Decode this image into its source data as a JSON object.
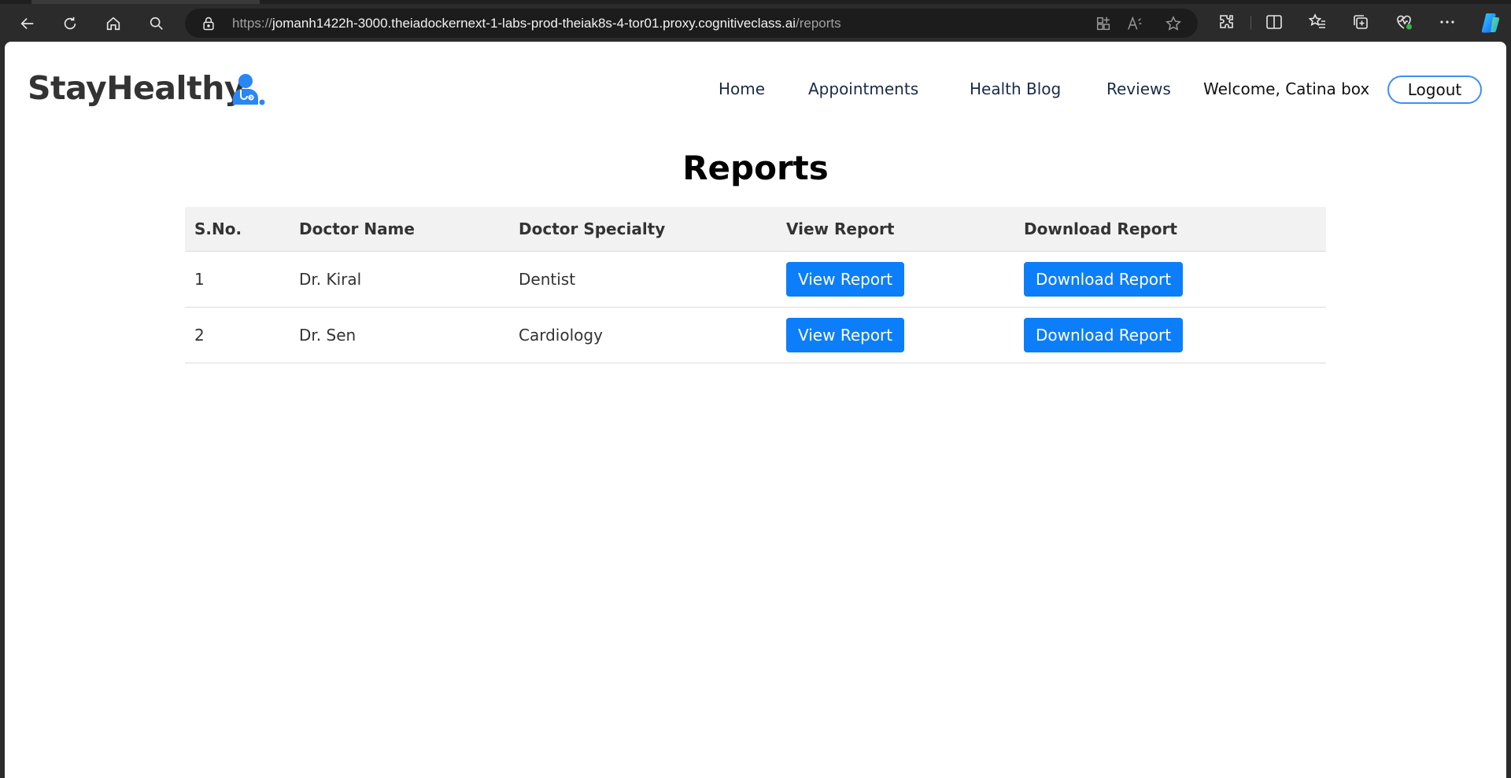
{
  "browser": {
    "url_scheme": "https://",
    "url_host": "jomanh1422h-3000.theiadockernext-1-labs-prod-theiak8s-4-tor01.proxy.cognitiveclass.ai",
    "url_path": "/reports",
    "icons": [
      "back-icon",
      "refresh-icon",
      "home-icon",
      "search-icon",
      "lock-icon",
      "apps-icon",
      "read-aloud-icon",
      "favorite-star-icon",
      "extensions-icon",
      "split-screen-icon",
      "favorites-icon",
      "collections-icon",
      "browser-health-icon",
      "more-icon",
      "copilot-icon"
    ]
  },
  "navbar": {
    "brand": "StayHealthy",
    "links": [
      "Home",
      "Appointments",
      "Health Blog",
      "Reviews"
    ],
    "welcome": "Welcome, Catina box",
    "logout": "Logout",
    "accent": "#3f8ef5"
  },
  "main": {
    "title": "Reports",
    "table": {
      "headers": [
        "S.No.",
        "Doctor Name",
        "Doctor Specialty",
        "View Report",
        "Download Report"
      ],
      "rows": [
        {
          "sno": "1",
          "name": "Dr. Kiral",
          "specialty": "Dentist",
          "view": "View Report",
          "download": "Download Report"
        },
        {
          "sno": "2",
          "name": "Dr. Sen",
          "specialty": "Cardiology",
          "view": "View Report",
          "download": "Download Report"
        }
      ]
    },
    "button_color": "#0d7ef9"
  }
}
